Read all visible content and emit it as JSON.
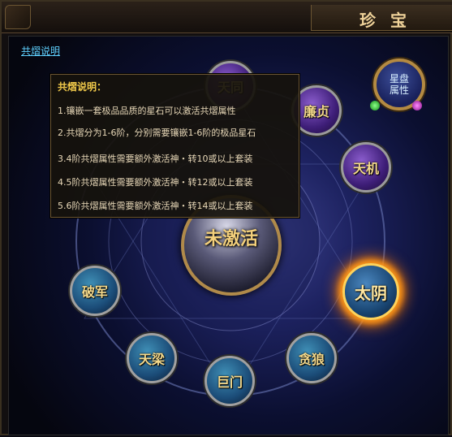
{
  "window": {
    "title": "珍宝"
  },
  "link": {
    "gongming": "共熠说明"
  },
  "emblem": {
    "line1": "星盘",
    "line2": "属性"
  },
  "center": {
    "label": "未激活"
  },
  "nodes": [
    {
      "key": "tiantong",
      "label": "天同",
      "style": "purple"
    },
    {
      "key": "lianzhen",
      "label": "廉贞",
      "style": "purple"
    },
    {
      "key": "tianji",
      "label": "天机",
      "style": "purple"
    },
    {
      "key": "taiyin",
      "label": "太阴",
      "style": "active"
    },
    {
      "key": "tanlang",
      "label": "贪狼",
      "style": "blue"
    },
    {
      "key": "jumen",
      "label": "巨门",
      "style": "blue"
    },
    {
      "key": "tianliang",
      "label": "天梁",
      "style": "blue"
    },
    {
      "key": "pojun",
      "label": "破军",
      "style": "blue"
    }
  ],
  "tooltip": {
    "title": "共熠说明：",
    "lines": [
      "1.镶嵌一套极品品质的星石可以激活共熠属性",
      "2.共熠分为1-6阶，分别需要镶嵌1-6阶的极品星石",
      "3.4阶共熠属性需要额外激活神・转10或以上套装",
      "4.5阶共熠属性需要额外激活神・转12或以上套装",
      "5.6阶共熠属性需要额外激活神・转14或以上套装"
    ]
  }
}
